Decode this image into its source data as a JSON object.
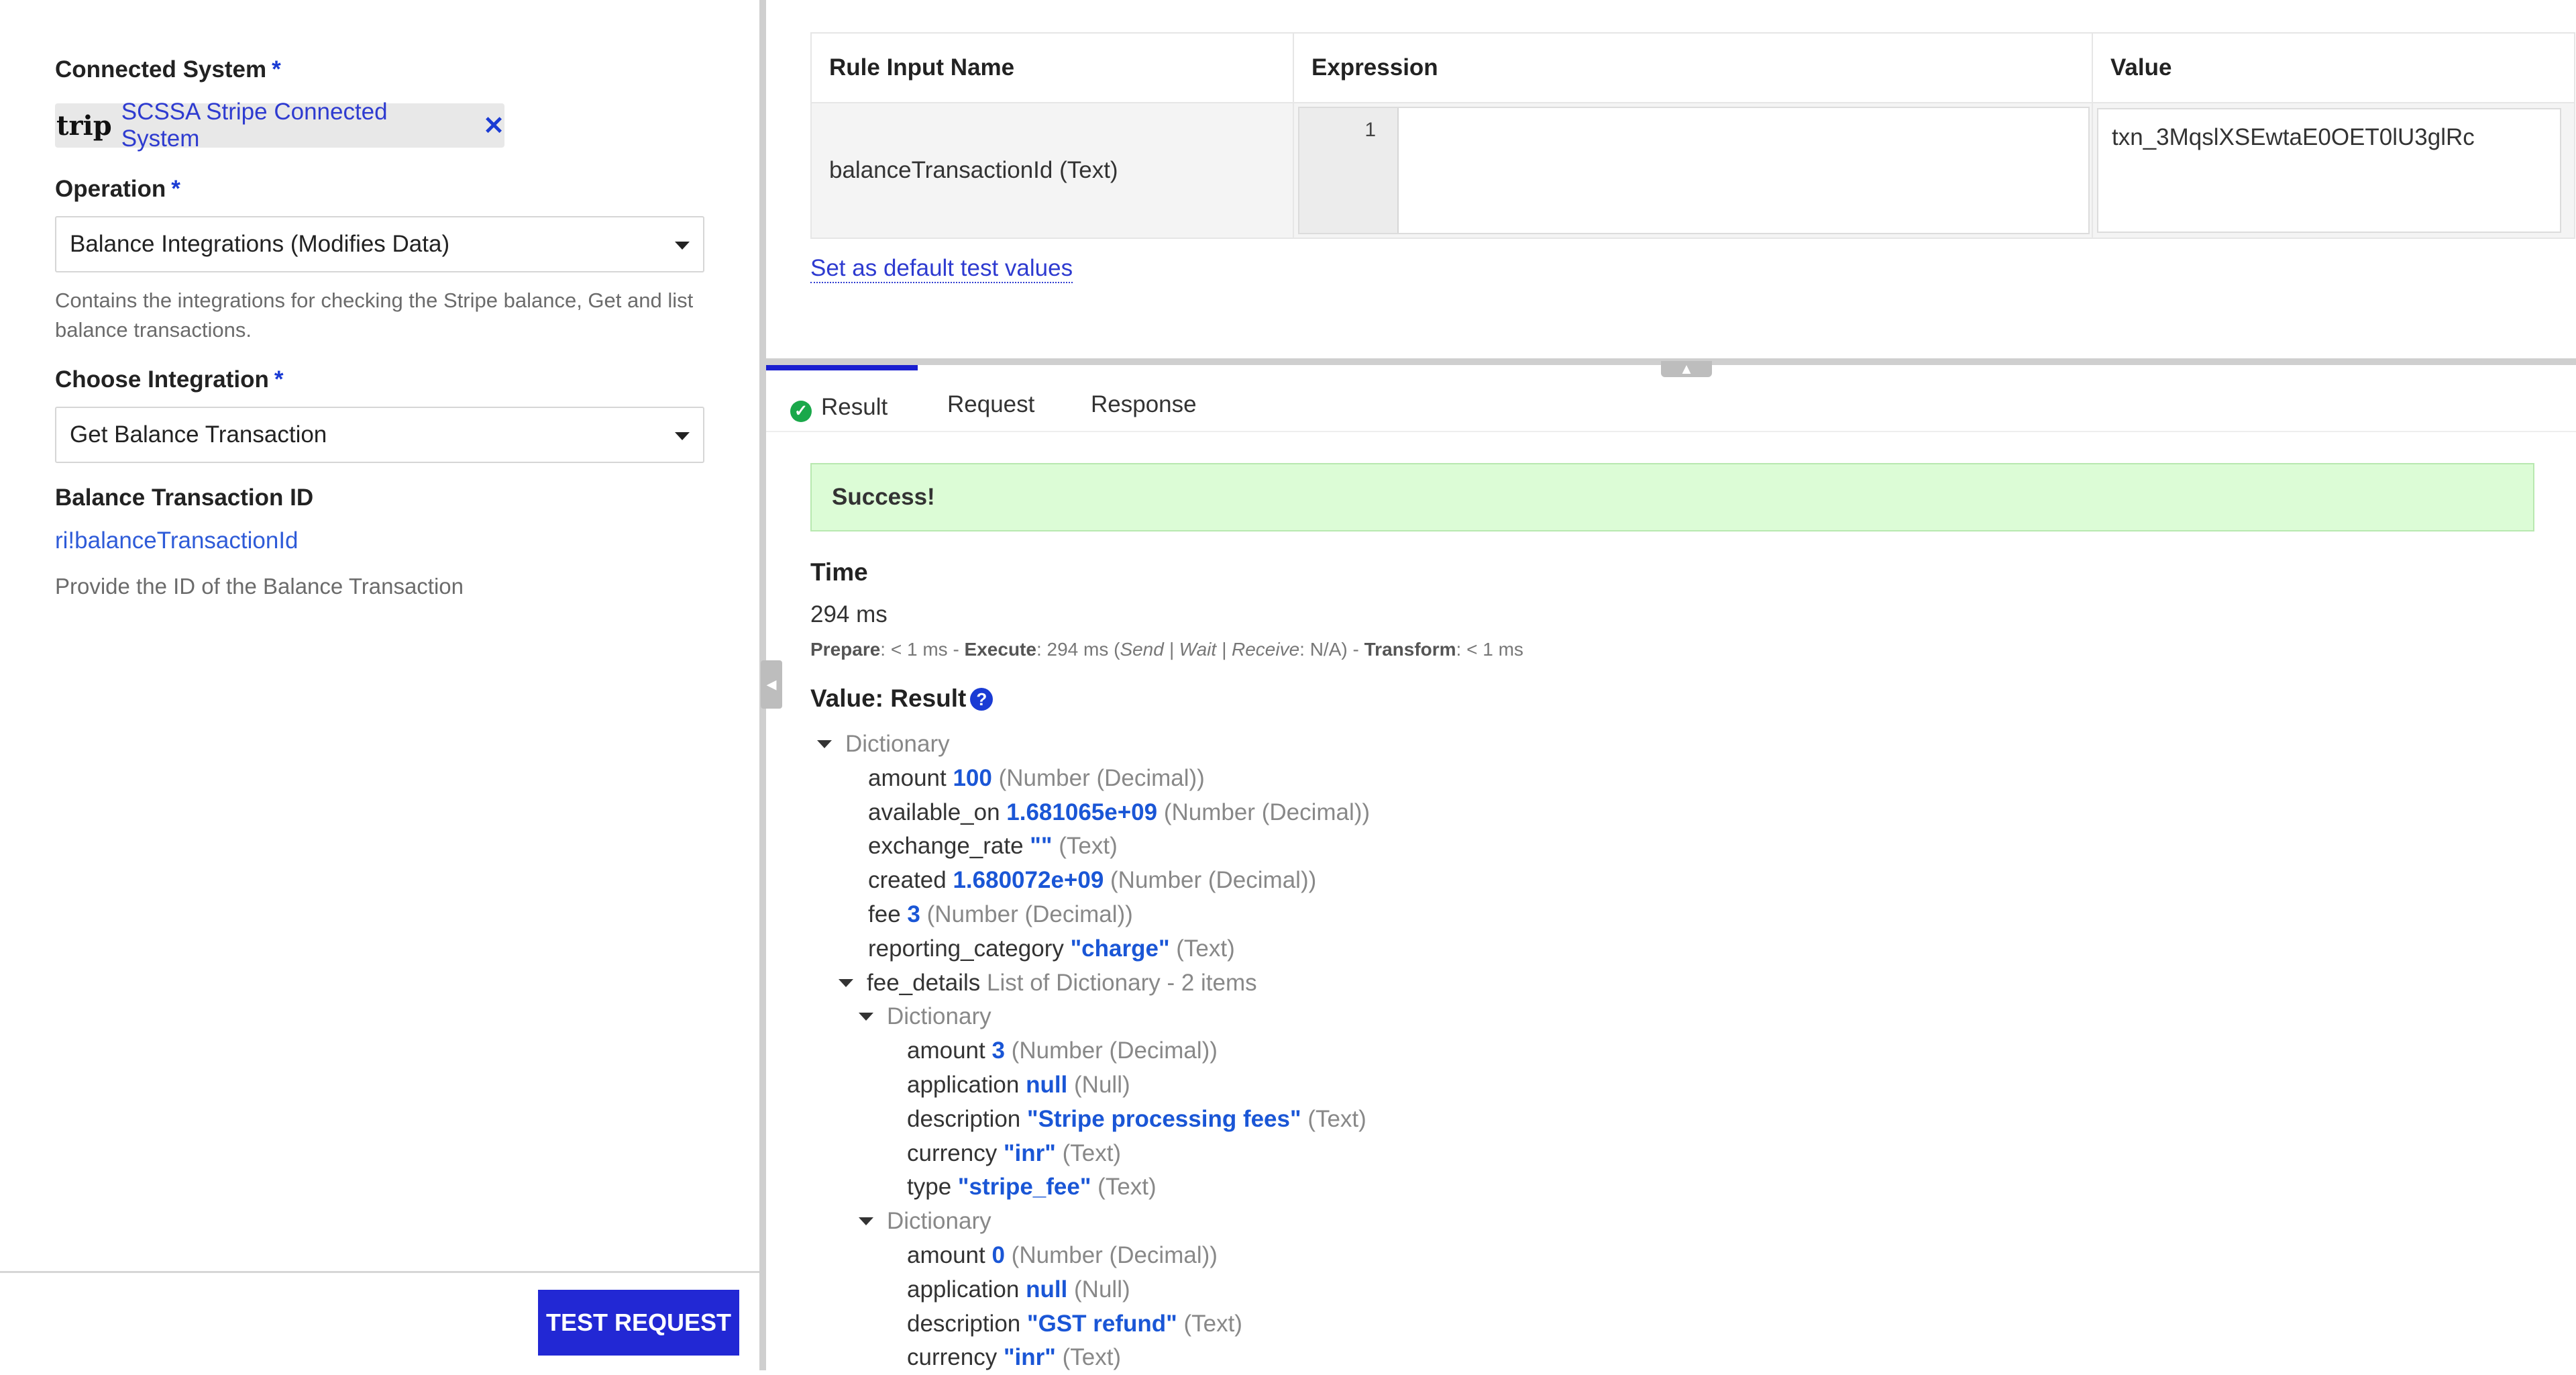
{
  "left": {
    "connected_system_label": "Connected System",
    "required_mark": "*",
    "connected_system_logo": "trip",
    "connected_system_value": "SCSSA Stripe Connected System",
    "operation_label": "Operation",
    "operation_value": "Balance Integrations (Modifies Data)",
    "operation_help": "Contains the integrations for checking the Stripe balance, Get and list balance transactions.",
    "integration_label": "Choose Integration",
    "integration_value": "Get Balance Transaction",
    "balance_id_label": "Balance Transaction ID",
    "balance_id_value": "ri!balanceTransactionId",
    "balance_id_help": "Provide the ID of the Balance Transaction",
    "test_button": "TEST REQUEST"
  },
  "rule_table": {
    "headers": [
      "Rule Input Name",
      "Expression",
      "Value"
    ],
    "row": {
      "name": "balanceTransactionId (Text)",
      "line_no": "1",
      "value": "txn_3MqslXSEwtaE0OET0lU3glRc"
    }
  },
  "set_default_link": "Set as default test values",
  "tabs": [
    "Result",
    "Request",
    "Response"
  ],
  "success_text": "Success!",
  "time_heading": "Time",
  "time_value": "294 ms",
  "timing_detail": {
    "prepare_label": "Prepare",
    "prepare_value": ": < 1 ms - ",
    "execute_label": "Execute",
    "execute_value": ": 294 ms (",
    "execute_sub": "Send | Wait | Receive",
    "execute_sub_value": ": N/A) - ",
    "transform_label": "Transform",
    "transform_value": ": < 1 ms"
  },
  "value_heading": "Value: Result",
  "tree": [
    {
      "indent": 0,
      "toggle": true,
      "key": "",
      "value": "",
      "type": "Dictionary"
    },
    {
      "indent": 1,
      "toggle": false,
      "key": "amount",
      "value": "100",
      "type": "(Number (Decimal))"
    },
    {
      "indent": 1,
      "toggle": false,
      "key": "available_on",
      "value": "1.681065e+09",
      "type": "(Number (Decimal))"
    },
    {
      "indent": 1,
      "toggle": false,
      "key": "exchange_rate",
      "value": "\"\"",
      "type": "(Text)"
    },
    {
      "indent": 1,
      "toggle": false,
      "key": "created",
      "value": "1.680072e+09",
      "type": "(Number (Decimal))"
    },
    {
      "indent": 1,
      "toggle": false,
      "key": "fee",
      "value": "3",
      "type": "(Number (Decimal))"
    },
    {
      "indent": 1,
      "toggle": false,
      "key": "reporting_category",
      "value": "\"charge\"",
      "type": "(Text)"
    },
    {
      "indent": 1,
      "toggle": true,
      "key": "fee_details",
      "value": "",
      "type": "List of Dictionary - 2 items"
    },
    {
      "indent": 2,
      "toggle": true,
      "key": "",
      "value": "",
      "type": "Dictionary"
    },
    {
      "indent": 3,
      "toggle": false,
      "key": "amount",
      "value": "3",
      "type": "(Number (Decimal))"
    },
    {
      "indent": 3,
      "toggle": false,
      "key": "application",
      "value": "null",
      "type": "(Null)"
    },
    {
      "indent": 3,
      "toggle": false,
      "key": "description",
      "value": "\"Stripe processing fees\"",
      "type": "(Text)"
    },
    {
      "indent": 3,
      "toggle": false,
      "key": "currency",
      "value": "\"inr\"",
      "type": "(Text)"
    },
    {
      "indent": 3,
      "toggle": false,
      "key": "type",
      "value": "\"stripe_fee\"",
      "type": "(Text)"
    },
    {
      "indent": 2,
      "toggle": true,
      "key": "",
      "value": "",
      "type": "Dictionary"
    },
    {
      "indent": 3,
      "toggle": false,
      "key": "amount",
      "value": "0",
      "type": "(Number (Decimal))"
    },
    {
      "indent": 3,
      "toggle": false,
      "key": "application",
      "value": "null",
      "type": "(Null)"
    },
    {
      "indent": 3,
      "toggle": false,
      "key": "description",
      "value": "\"GST refund\"",
      "type": "(Text)"
    },
    {
      "indent": 3,
      "toggle": false,
      "key": "currency",
      "value": "\"inr\"",
      "type": "(Text)"
    }
  ]
}
